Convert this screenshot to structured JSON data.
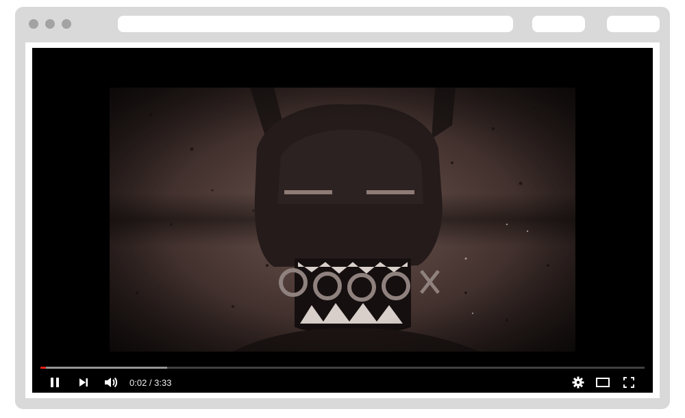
{
  "browser": {
    "url": "",
    "window_controls": [
      "close",
      "minimize",
      "maximize"
    ]
  },
  "player": {
    "state": "playing",
    "current_time": "0:02",
    "separator": " / ",
    "duration": "3:33",
    "progress_fraction": 0.0094,
    "buffered_fraction": 0.21,
    "accent_color": "#e52117",
    "icons": {
      "pause": "pause-icon",
      "next": "next-icon",
      "volume": "volume-icon",
      "settings": "gear-icon",
      "theater": "theater-mode-icon",
      "fullscreen": "fullscreen-icon"
    }
  }
}
